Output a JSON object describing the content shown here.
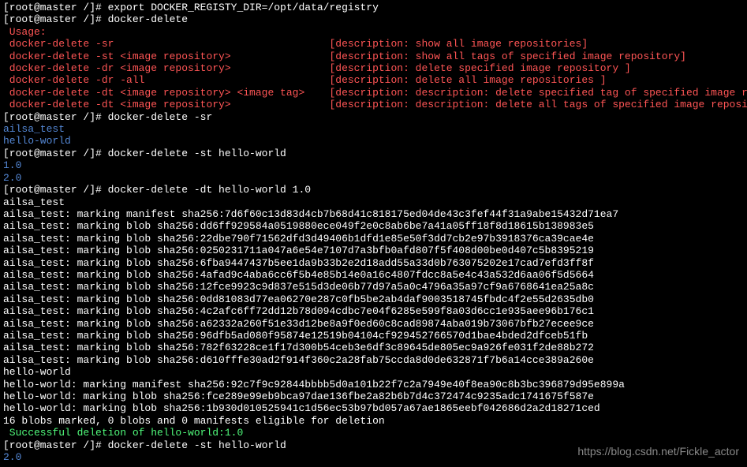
{
  "lines": [
    {
      "class": "white",
      "text": "[root@master /]# export DOCKER_REGISTY_DIR=/opt/data/registry"
    },
    {
      "class": "white",
      "text": "[root@master /]# docker-delete"
    },
    {
      "class": "red",
      "text": " Usage:"
    },
    {
      "class": "red",
      "text": " docker-delete -sr                                   [description: show all image repositories]"
    },
    {
      "class": "red",
      "text": " docker-delete -st <image repository>                [description: show all tags of specified image repository]"
    },
    {
      "class": "red",
      "text": " docker-delete -dr <image repository>                [description: delete specified image repository ]"
    },
    {
      "class": "red",
      "text": " docker-delete -dr -all                              [description: delete all image repositories ]"
    },
    {
      "class": "red",
      "text": " docker-delete -dt <image repository> <image tag>    [description: description: delete specified tag of specified image repository ]"
    },
    {
      "class": "red",
      "text": " docker-delete -dt <image repository>                [description: description: delete all tags of specified image repository ]"
    },
    {
      "class": "white",
      "text": "[root@master /]# docker-delete -sr"
    },
    {
      "class": "blue",
      "text": "ailsa_test"
    },
    {
      "class": "blue",
      "text": "hello-world"
    },
    {
      "class": "white",
      "text": "[root@master /]# docker-delete -st hello-world"
    },
    {
      "class": "blue",
      "text": "1.0"
    },
    {
      "class": "blue",
      "text": "2.0"
    },
    {
      "class": "white",
      "text": "[root@master /]# docker-delete -dt hello-world 1.0"
    },
    {
      "class": "white",
      "text": "ailsa_test"
    },
    {
      "class": "white",
      "text": "ailsa_test: marking manifest sha256:7d6f60c13d83d4cb7b68d41c818175ed04de43c3fef44f31a9abe15432d71ea7"
    },
    {
      "class": "white",
      "text": "ailsa_test: marking blob sha256:dd6ff929584a0519880ece049f2e0c8ab6be7a41a05ff18f8d18615b138983e5"
    },
    {
      "class": "white",
      "text": "ailsa_test: marking blob sha256:22dbe790f71562dfd3d49406b1dfd1e85e50f3dd7cb2e97b3918376ca39cae4e"
    },
    {
      "class": "white",
      "text": "ailsa_test: marking blob sha256:0250231711a047a6e54e7107d7a3bfb0afd807f5f408d00be0d407c5b8395219"
    },
    {
      "class": "white",
      "text": "ailsa_test: marking blob sha256:6fba9447437b5ee1da9b33b2e2d18add55a33d0b763075202e17cad7efd3ff8f"
    },
    {
      "class": "white",
      "text": "ailsa_test: marking blob sha256:4afad9c4aba6cc6f5b4e85b14e0a16c4807fdcc8a5e4c43a532d6aa06f5d5664"
    },
    {
      "class": "white",
      "text": "ailsa_test: marking blob sha256:12fce9923c9d837e515d3de06b77d97a5a0c4796a35a97cf9a6768641ea25a8c"
    },
    {
      "class": "white",
      "text": "ailsa_test: marking blob sha256:0dd81083d77ea06270e287c0fb5be2ab4daf9003518745fbdc4f2e55d2635db0"
    },
    {
      "class": "white",
      "text": "ailsa_test: marking blob sha256:4c2afc6ff72dd12b78d094cdbc7e04f6285e599f8a03d6cc1e935aee96b176c1"
    },
    {
      "class": "white",
      "text": "ailsa_test: marking blob sha256:a62332a260f51e33d12be8a9f0ed60c8cad89874aba019b73067bfb27ecee9ce"
    },
    {
      "class": "white",
      "text": "ailsa_test: marking blob sha256:96dfb5ad080f95874e12519b04104cf929452766570d1bae4bded2dfceb51fb"
    },
    {
      "class": "white",
      "text": "ailsa_test: marking blob sha256:782f63228ce1f17d300b54ceb3e6df3c89645de805ec9a926fe031f2de88b272"
    },
    {
      "class": "white",
      "text": "ailsa_test: marking blob sha256:d610fffe30ad2f914f360c2a28fab75ccda8d0de632871f7b6a14cce389a260e"
    },
    {
      "class": "white",
      "text": "hello-world"
    },
    {
      "class": "white",
      "text": "hello-world: marking manifest sha256:92c7f9c92844bbbb5d0a101b22f7c2a7949e40f8ea90c8b3bc396879d95e899a"
    },
    {
      "class": "white",
      "text": "hello-world: marking blob sha256:fce289e99eb9bca97dae136fbe2a82b6b7d4c372474c9235adc1741675f587e"
    },
    {
      "class": "white",
      "text": "hello-world: marking blob sha256:1b930d010525941c1d56ec53b97bd057a67ae1865eebf042686d2a2d18271ced"
    },
    {
      "class": "white",
      "text": ""
    },
    {
      "class": "white",
      "text": "16 blobs marked, 0 blobs and 0 manifests eligible for deletion"
    },
    {
      "class": "green",
      "text": " Successful deletion of hello-world:1.0"
    },
    {
      "class": "white",
      "text": "[root@master /]# docker-delete -st hello-world"
    },
    {
      "class": "blue",
      "text": "2.0"
    }
  ],
  "watermark": "https://blog.csdn.net/Fickle_actor"
}
